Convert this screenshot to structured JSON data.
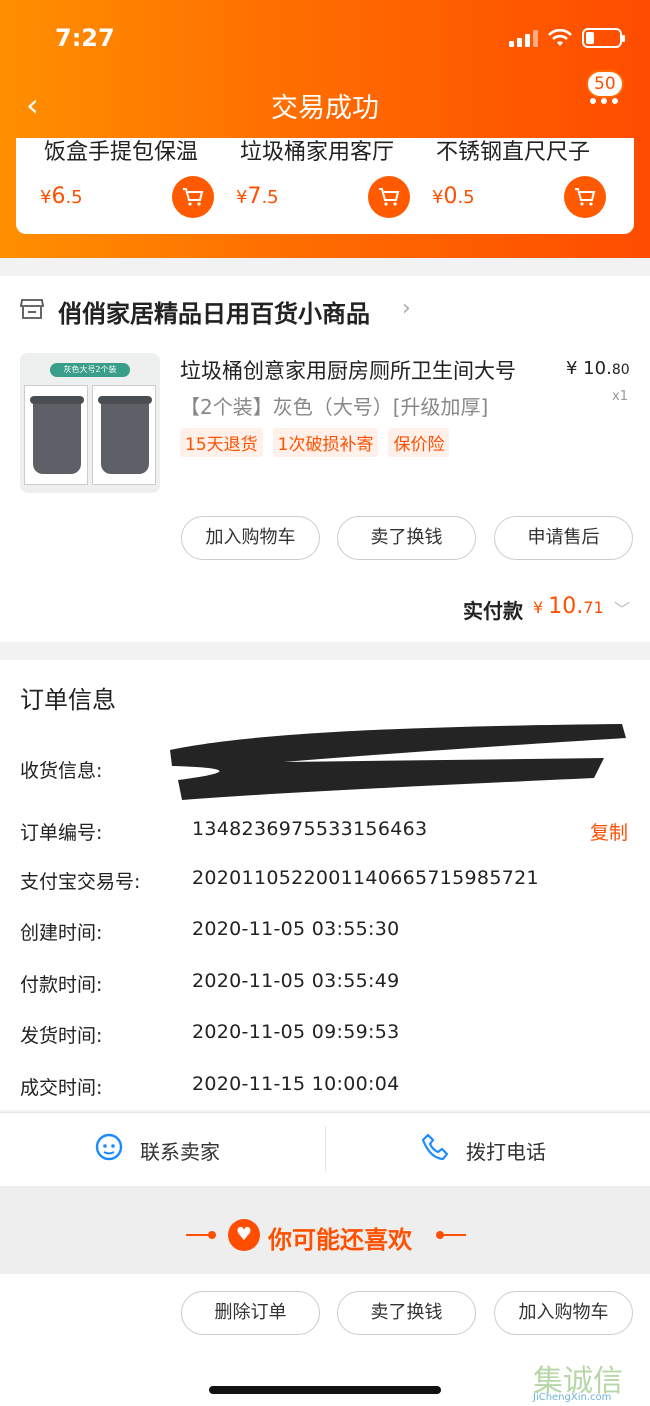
{
  "status_bar": {
    "time": "7:27"
  },
  "nav": {
    "title": "交易成功",
    "back_icon": "‹",
    "badge": "50"
  },
  "recommended": [
    {
      "name": "饭盒手提包保温",
      "currency": "¥",
      "price_int": "6",
      "price_dec": ".5"
    },
    {
      "name": "垃圾桶家用客厅",
      "currency": "¥",
      "price_int": "7",
      "price_dec": ".5"
    },
    {
      "name": "不锈钢直尺尺子",
      "currency": "¥",
      "price_int": "0",
      "price_dec": ".5"
    }
  ],
  "shop": {
    "name": "俏俏家居精品日用百货小商品"
  },
  "product": {
    "image_tag": "灰色大号2个装",
    "title": "垃圾桶创意家用厨房厕所卫生间大号",
    "spec": "【2个装】灰色（大号）[升级加厚]",
    "price_int": "¥ 10.",
    "price_dec": "80",
    "qty": "x1",
    "tags": [
      "15天退货",
      "1次破损补寄",
      "保价险"
    ],
    "actions": [
      "加入购物车",
      "卖了换钱",
      "申请售后"
    ]
  },
  "payment": {
    "label": "实付款",
    "currency": "¥ ",
    "amount_int": "10.",
    "amount_dec": "71"
  },
  "order": {
    "title": "订单信息",
    "receiver_label": "收货信息:",
    "order_no_label": "订单编号:",
    "order_no": "1348236975533156463",
    "copy": "复制",
    "alipay_label": "支付宝交易号:",
    "alipay_no": "2020110522001140665715985721",
    "created_label": "创建时间:",
    "created": "2020-11-05 03:55:30",
    "paid_label": "付款时间:",
    "paid": "2020-11-05 03:55:49",
    "shipped_label": "发货时间:",
    "shipped": "2020-11-05 09:59:53",
    "closed_label": "成交时间:",
    "closed": "2020-11-15 10:00:04"
  },
  "contact": {
    "seller": "联系卖家",
    "phone": "拨打电话"
  },
  "recommend_title": "你可能还喜欢",
  "bottom_actions": [
    "删除订单",
    "卖了换钱",
    "加入购物车"
  ],
  "watermark": {
    "text": "集诚信",
    "sub": "JiChengXin.com"
  },
  "colors": {
    "accent": "#ff5000",
    "header_start": "#ff8f00",
    "header_end": "#ff4c00"
  }
}
